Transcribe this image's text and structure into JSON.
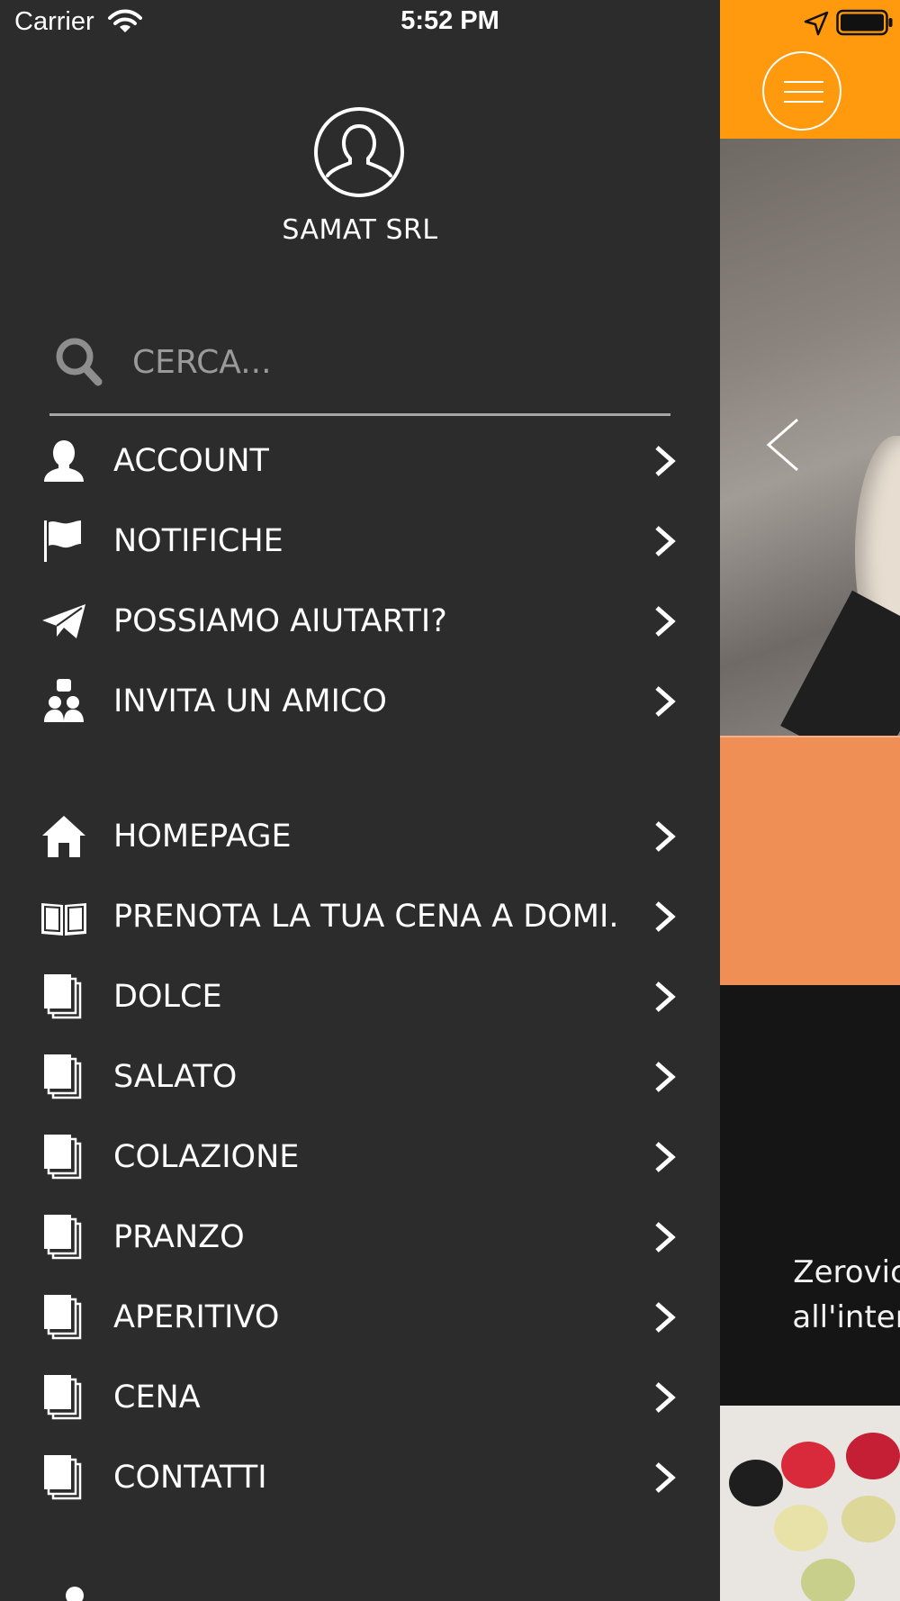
{
  "status_bar": {
    "carrier": "Carrier",
    "time": "5:52 PM",
    "icons": [
      "wifi-icon",
      "location-arrow-icon",
      "battery-icon"
    ]
  },
  "profile": {
    "name": "SAMAT SRL",
    "avatar_icon": "user-outline-icon"
  },
  "search": {
    "placeholder": "CERCA...",
    "value": "",
    "icon": "search-icon"
  },
  "menu_group_1": [
    {
      "label": "ACCOUNT",
      "icon": "user-icon"
    },
    {
      "label": "NOTIFICHE",
      "icon": "flag-icon"
    },
    {
      "label": "POSSIAMO AIUTARTI?",
      "icon": "paper-plane-icon"
    },
    {
      "label": "INVITA UN AMICO",
      "icon": "invite-friend-icon"
    }
  ],
  "menu_group_2": [
    {
      "label": "HOMEPAGE",
      "icon": "home-icon"
    },
    {
      "label": "PRENOTA LA TUA CENA A DOMI...",
      "icon": "open-book-icon"
    },
    {
      "label": "DOLCE",
      "icon": "pages-icon"
    },
    {
      "label": "SALATO",
      "icon": "pages-icon"
    },
    {
      "label": "COLAZIONE",
      "icon": "pages-icon"
    },
    {
      "label": "PRANZO",
      "icon": "pages-icon"
    },
    {
      "label": "APERITIVO",
      "icon": "pages-icon"
    },
    {
      "label": "CENA",
      "icon": "pages-icon"
    },
    {
      "label": "CONTATTI",
      "icon": "pages-icon"
    }
  ],
  "app_content": {
    "header_color": "#ff9a0e",
    "menu_button_icon": "hamburger-icon",
    "slider_prev_icon": "chevron-left-icon",
    "promo_text": "Zerovice\nall'intern"
  },
  "colors": {
    "drawer_bg": "#2c2c2c",
    "accent_orange": "#ff9a0e",
    "band_orange": "#f08f55",
    "text": "#ffffff"
  }
}
